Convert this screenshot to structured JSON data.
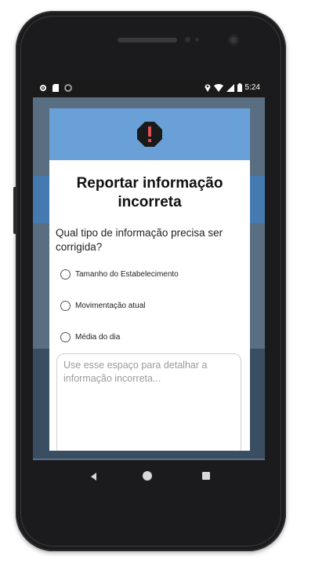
{
  "status_bar": {
    "time": "5:24",
    "left_icons": [
      "gear-icon",
      "sim-icon",
      "sync-icon"
    ],
    "right_icons": [
      "location-icon",
      "wifi-icon",
      "signal-icon",
      "battery-icon"
    ]
  },
  "dialog": {
    "header_icon": "alert-octagon-icon",
    "header_color": "#6aa0d8",
    "title": "Reportar informação incorreta",
    "question": "Qual tipo de informação precisa ser corrigida?",
    "options": [
      {
        "label": "Tamanho do Estabelecimento",
        "selected": false
      },
      {
        "label": "Movimentação atual",
        "selected": false
      },
      {
        "label": "Média do dia",
        "selected": false
      }
    ],
    "details_placeholder": "Use esse espaço para detalhar a informação incorreta..."
  },
  "nav_bar": {
    "back_icon": "back-triangle-icon",
    "home_icon": "home-circle-icon",
    "recent_icon": "recent-square-icon"
  }
}
